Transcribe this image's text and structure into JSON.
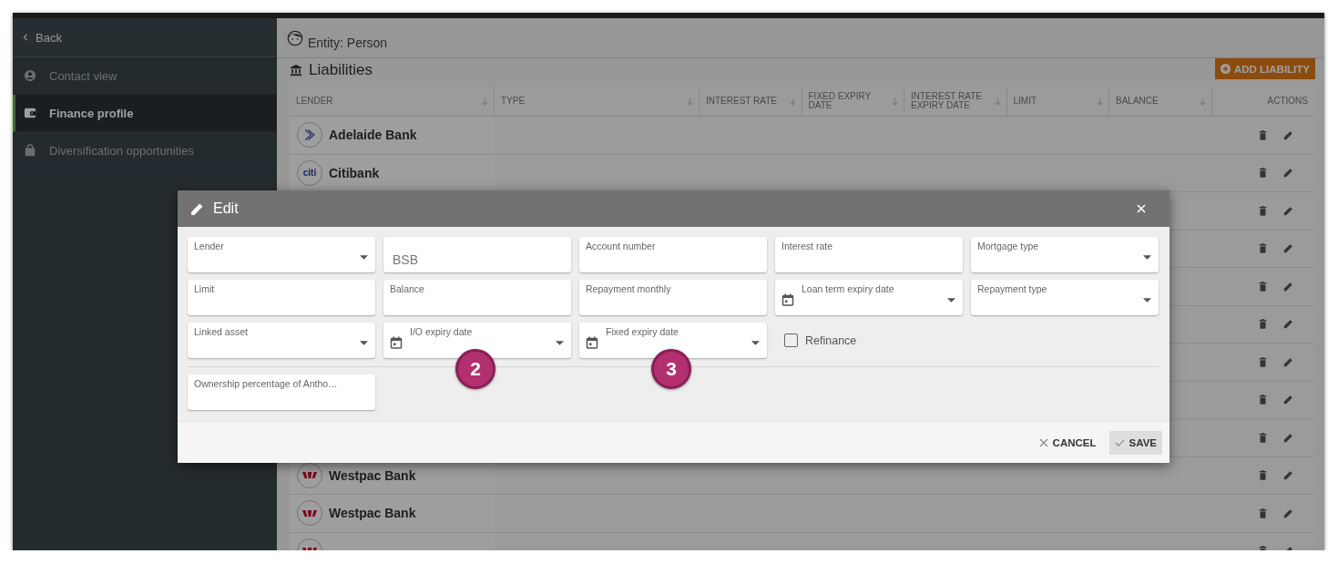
{
  "sidebar": {
    "back": "Back",
    "items": [
      {
        "label": "Contact view",
        "selected": false
      },
      {
        "label": "Finance profile",
        "selected": true
      },
      {
        "label": "Diversification opportunities",
        "selected": false
      }
    ]
  },
  "header": {
    "entity": "Entity: Person"
  },
  "section": {
    "title": "Liabilities",
    "add_button": "ADD LIABILITY"
  },
  "table": {
    "columns": [
      {
        "label": "LENDER",
        "sortable": true
      },
      {
        "label": "TYPE",
        "sortable": true
      },
      {
        "label": "INTEREST RATE",
        "sortable": true
      },
      {
        "label": "FIXED EXPIRY DATE",
        "sortable": true
      },
      {
        "label": "INTEREST RATE EXPIRY DATE",
        "sortable": true
      },
      {
        "label": "LIMIT",
        "sortable": true
      },
      {
        "label": "BALANCE",
        "sortable": true
      },
      {
        "label": "ACTIONS",
        "sortable": false
      }
    ],
    "rows": [
      {
        "lender": "Adelaide Bank",
        "kind": "chevrons"
      },
      {
        "lender": "Citibank",
        "kind": "wordmark",
        "logo_text": "citi"
      },
      {},
      {},
      {},
      {},
      {},
      {},
      {},
      {
        "lender": "Westpac Bank",
        "kind": "w-mark"
      },
      {
        "lender": "Westpac Bank",
        "kind": "w-mark"
      },
      {
        "kind": "w-mark"
      }
    ]
  },
  "dialog": {
    "title": "Edit",
    "fields": [
      {
        "kind": "select",
        "label": "Lender"
      },
      {
        "kind": "text",
        "placeholder": "BSB"
      },
      {
        "kind": "text",
        "label": "Account number"
      },
      {
        "kind": "text",
        "label": "Interest rate"
      },
      {
        "kind": "select",
        "label": "Mortgage type"
      },
      {
        "kind": "text",
        "label": "Limit"
      },
      {
        "kind": "text",
        "label": "Balance"
      },
      {
        "kind": "text",
        "label": "Repayment monthly"
      },
      {
        "kind": "date",
        "label": "Loan term expiry date"
      },
      {
        "kind": "select",
        "label": "Repayment type"
      },
      {
        "kind": "select",
        "label": "Linked asset"
      },
      {
        "kind": "date",
        "label": "I/O expiry date"
      },
      {
        "kind": "date",
        "label": "Fixed expiry date"
      },
      {
        "kind": "checkbox",
        "label": "Refinance",
        "checked": false
      }
    ],
    "extra_fields": [
      {
        "kind": "text",
        "label": "Ownership percentage of Antho…"
      }
    ],
    "buttons": [
      {
        "kind": "cancel",
        "label": "CANCEL"
      },
      {
        "kind": "save",
        "label": "SAVE"
      }
    ],
    "callouts": [
      "2",
      "3"
    ]
  }
}
